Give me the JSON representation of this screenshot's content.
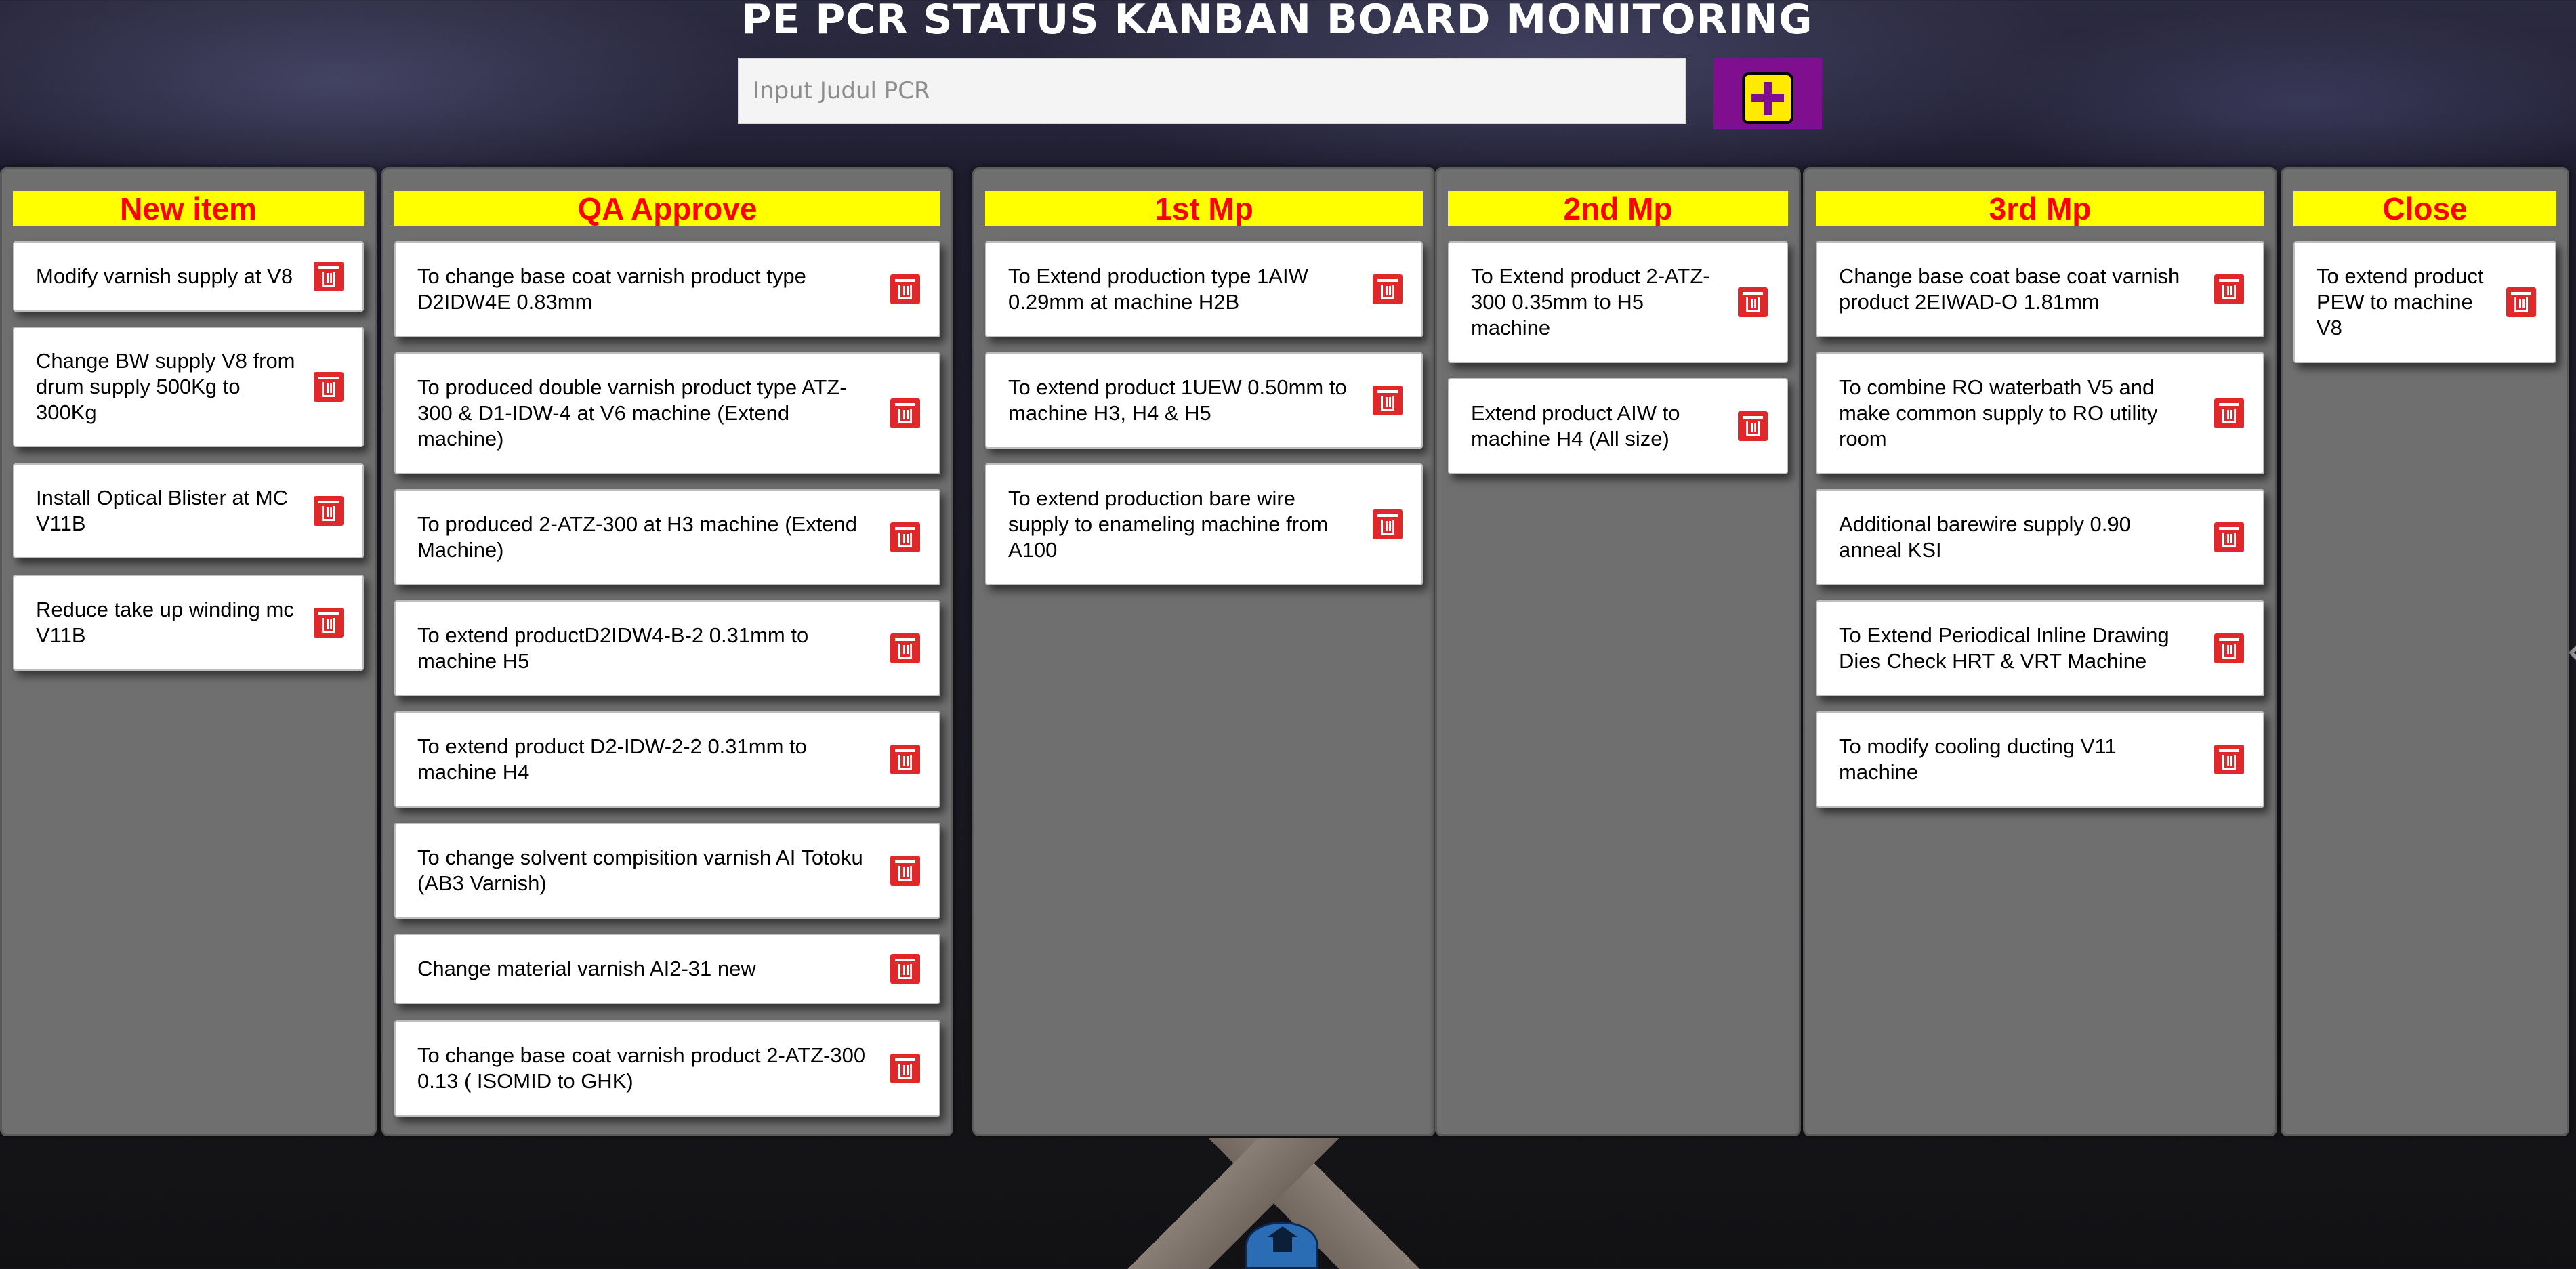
{
  "header": {
    "title": "PE PCR STATUS KANBAN BOARD MONITORING",
    "input_placeholder": "Input Judul PCR"
  },
  "colors": {
    "column_header_bg": "#ffff00",
    "column_header_text": "#ff0000",
    "add_button": "#7f0f8f",
    "delete_button": "#e0282b"
  },
  "columns": [
    {
      "title": "New item",
      "cards": [
        "Modify varnish supply at V8",
        "Change BW supply V8 from drum supply 500Kg to 300Kg",
        "Install Optical Blister at MC V11B",
        "Reduce take up winding mc V11B"
      ]
    },
    {
      "title": "QA Approve",
      "cards": [
        "To change base coat varnish product type D2IDW4E 0.83mm",
        "To produced double varnish product type ATZ-300 & D1-IDW-4 at V6 machine (Extend machine)",
        "To produced 2-ATZ-300 at H3 machine (Extend Machine)",
        "To extend productD2IDW4-B-2 0.31mm to machine H5",
        "To extend product D2-IDW-2-2 0.31mm to machine H4",
        "To change solvent compisition varnish AI Totoku (AB3 Varnish)",
        "Change material varnish AI2-31 new",
        "To change base coat varnish product 2-ATZ-300 0.13 ( ISOMID to GHK)"
      ]
    },
    {
      "title": "1st Mp",
      "cards": [
        "To Extend production type 1AIW 0.29mm at machine H2B",
        "To extend product 1UEW 0.50mm to machine H3, H4 & H5",
        "To extend production bare wire supply to enameling machine from A100"
      ]
    },
    {
      "title": "2nd Mp",
      "cards": [
        "To Extend product 2-ATZ-300 0.35mm to H5 machine",
        "Extend product AIW to machine H4 (All size)"
      ]
    },
    {
      "title": "3rd Mp",
      "cards": [
        "Change base coat base coat varnish product 2EIWAD-O 1.81mm",
        "To combine RO waterbath V5 and make common supply to RO utility room",
        "Additional barewire supply 0.90 anneal KSI",
        "To Extend Periodical Inline Drawing Dies Check HRT & VRT Machine",
        "To modify cooling ducting V11 machine"
      ]
    },
    {
      "title": "Close",
      "cards": [
        "To extend product PEW to machine V8"
      ]
    }
  ]
}
